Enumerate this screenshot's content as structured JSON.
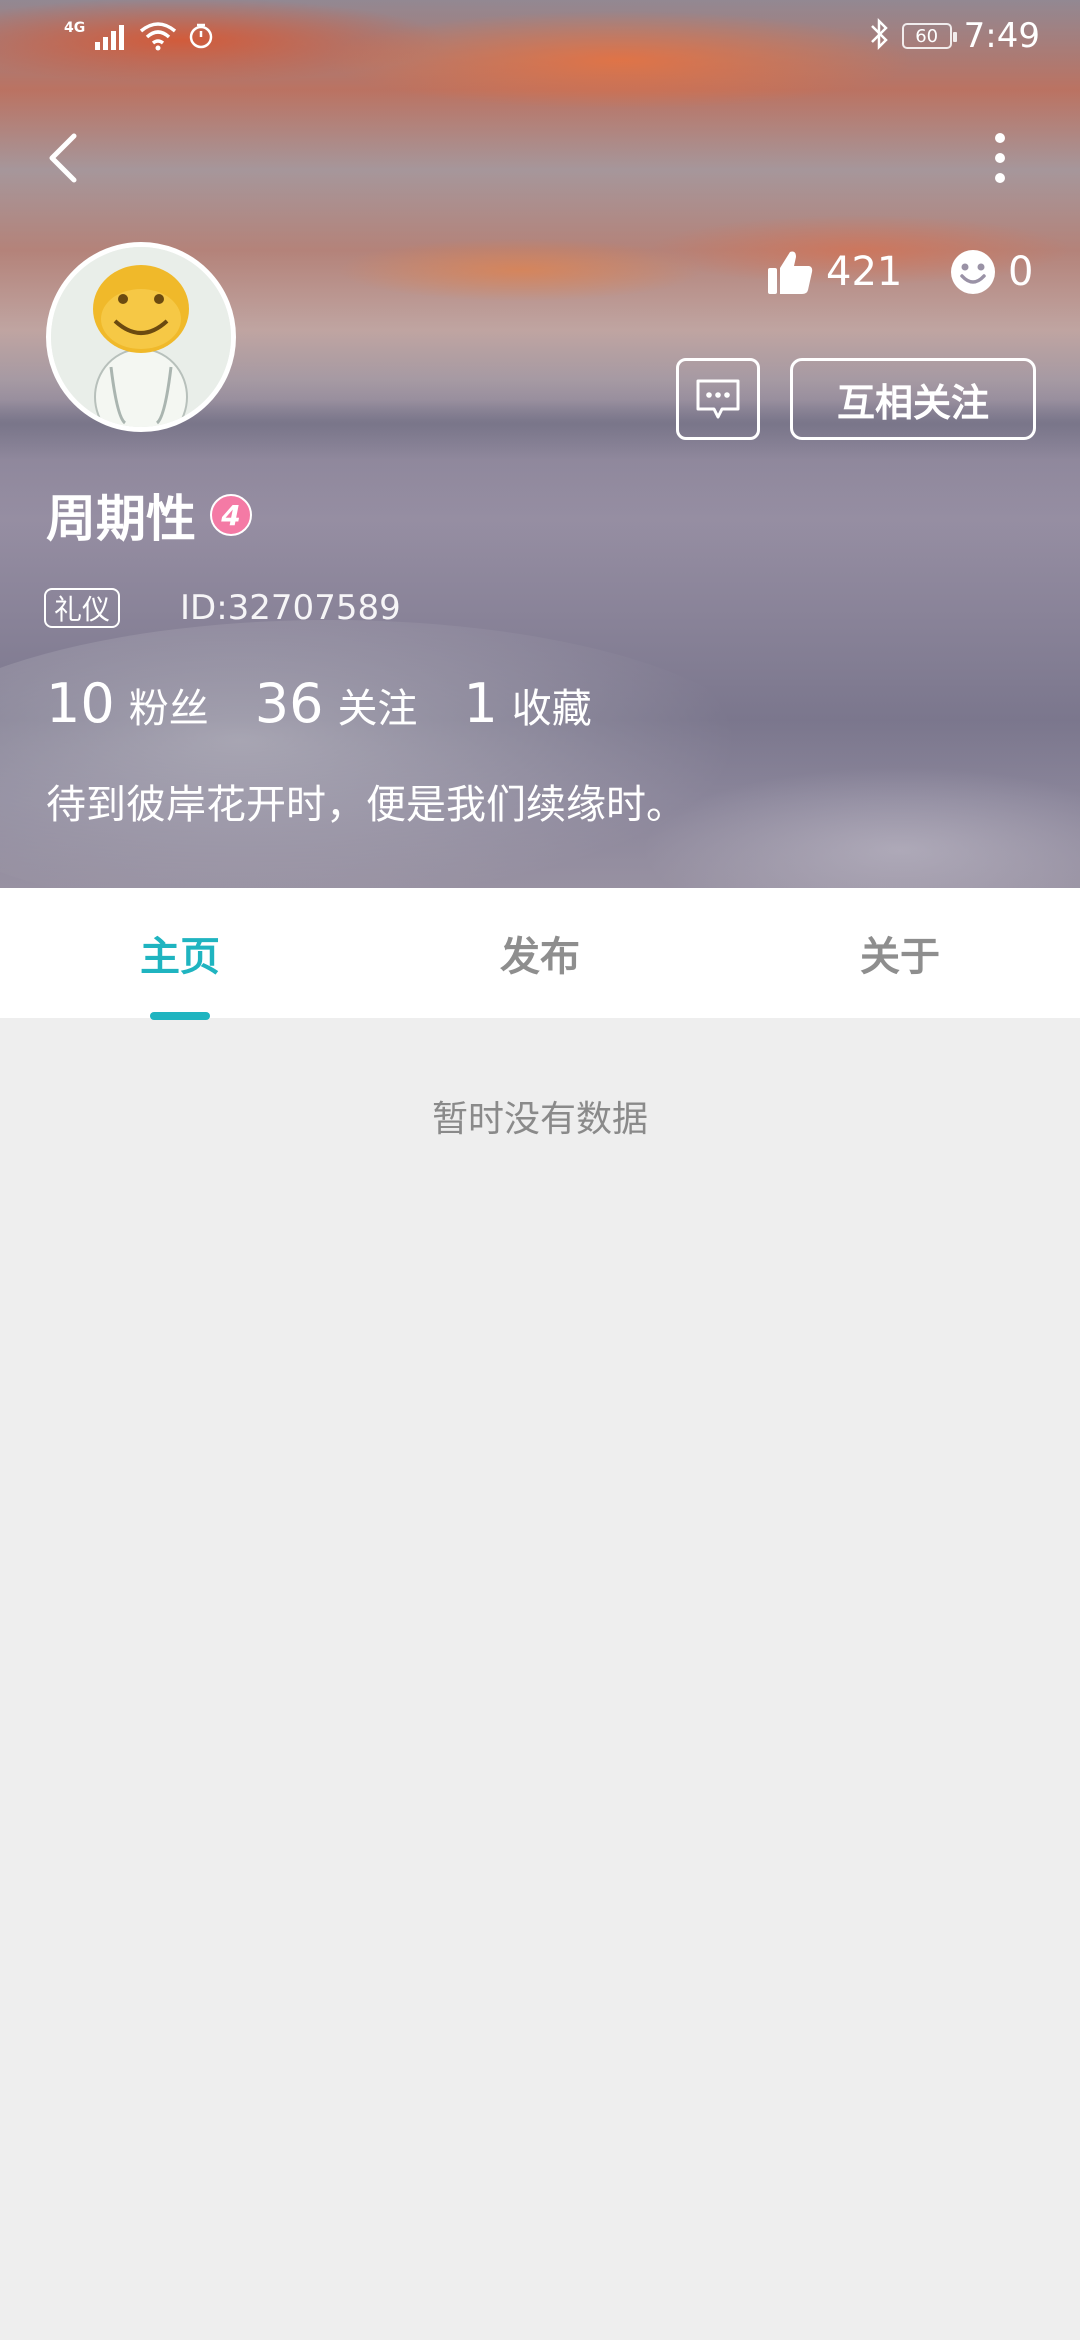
{
  "status_bar": {
    "network": "4G",
    "battery": "60",
    "time": "7:49"
  },
  "profile": {
    "likes": "421",
    "smiles": "0",
    "follow_button": "互相关注",
    "username": "周期性",
    "level": "4",
    "tag": "礼仪",
    "id": "ID:32707589",
    "fans_count": "10",
    "fans_label": "粉丝",
    "following_count": "36",
    "following_label": "关注",
    "favorites_count": "1",
    "favorites_label": "收藏",
    "bio": "待到彼岸花开时，便是我们续缘时。"
  },
  "tabs": [
    {
      "label": "主页"
    },
    {
      "label": "发布"
    },
    {
      "label": "关于"
    }
  ],
  "content": {
    "empty_text": "暂时没有数据"
  },
  "colors": {
    "accent": "#1fb4c0",
    "level_badge": "#f47aa5",
    "background": "#eeeeee"
  },
  "icons": [
    "back-arrow-icon",
    "more-vertical-icon",
    "thumbs-up-icon",
    "smiley-icon",
    "chat-bubble-icon",
    "signal-icon",
    "wifi-icon",
    "alarm-icon",
    "bluetooth-icon"
  ]
}
